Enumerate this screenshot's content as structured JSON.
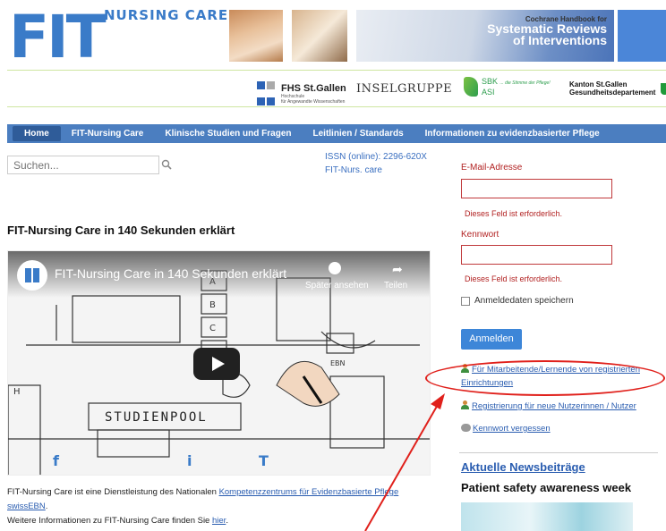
{
  "header": {
    "logo_main": "FIT",
    "logo_sub": "NURSING CARE",
    "logo_dot": ".",
    "banner_line1": "Cochrane Handbook for",
    "banner_line2": "Systematic Reviews",
    "banner_line3": "of Interventions"
  },
  "sponsors": {
    "fhs_name": "FHS St.Gallen",
    "fhs_sub1": "Hochschule",
    "fhs_sub2": "für Angewandte Wissenschaften",
    "insel": "INSELGRUPPE",
    "sbk": "SBK",
    "asi": "ASI",
    "sbk_tagline": "... die Stimme der Pflege!",
    "kanton_line1": "Kanton St.Gallen",
    "kanton_line2": "Gesundheitsdepartement"
  },
  "nav": {
    "items": [
      "Home",
      "FIT-Nursing Care",
      "Klinische Studien und Fragen",
      "Leitlinien / Standards",
      "Informationen zu evidenzbasierter Pflege"
    ]
  },
  "search": {
    "placeholder": "Suchen..."
  },
  "issn": {
    "line1": "ISSN (online): 2296-620X",
    "line2": "FIT-Nurs. care"
  },
  "video": {
    "heading": "FIT-Nursing Care in 140 Sekunden erklärt",
    "caption": "FIT-Nursing Care in 140 Sekunden erklärt",
    "watch_later": "Später ansehen",
    "share": "Teilen",
    "board_label": "STUDIENPOOL"
  },
  "footer": {
    "text1": "FIT-Nursing Care ist eine Dienstleistung des Nationalen ",
    "link1": "Kompetenzzentrums für Evidenzbasierte Pflege swissEBN",
    "text1_end": ".",
    "text2": "Weitere Informationen zu FIT-Nursing Care finden Sie ",
    "link2": "hier",
    "text2_end": "."
  },
  "login": {
    "email_label": "E-Mail-Adresse",
    "email_value": "",
    "email_error": "Dieses Feld ist erforderlich.",
    "password_label": "Kennwort",
    "password_value": "",
    "password_error": "Dieses Feld ist erforderlich.",
    "remember_label": "Anmeldedaten speichern",
    "submit": "Anmelden",
    "link_members": "Für Mitarbeitende/Lernende von registrierten Einrichtungen",
    "link_register": "Registrierung für neue Nutzerinnen / Nutzer",
    "link_forgot": "Kennwort vergessen"
  },
  "news": {
    "heading": "Aktuelle Newsbeiträge",
    "title": "Patient safety awareness week"
  },
  "colors": {
    "brand_blue": "#3a7bc8",
    "nav_blue": "#4b7ec0",
    "error_red": "#b22222",
    "annotation_red": "#e0201b"
  }
}
